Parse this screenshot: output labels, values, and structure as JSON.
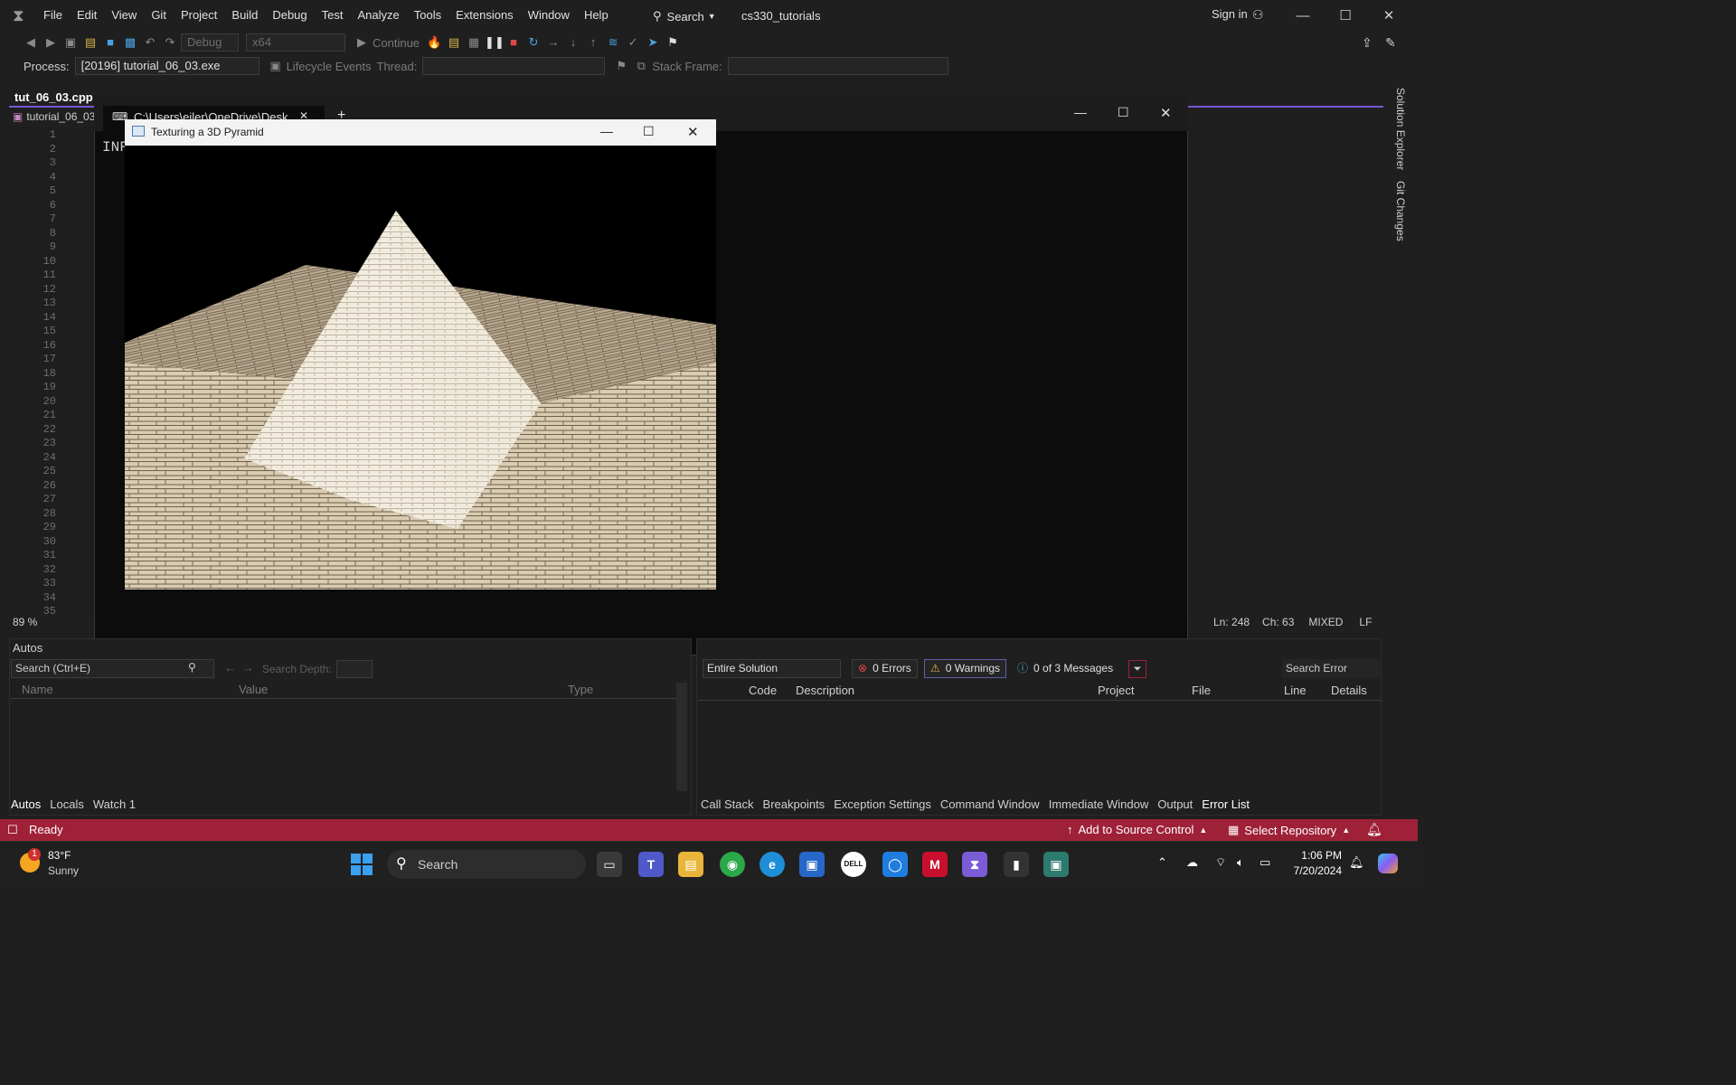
{
  "menubar": {
    "items": [
      "File",
      "Edit",
      "View",
      "Git",
      "Project",
      "Build",
      "Debug",
      "Test",
      "Analyze",
      "Tools",
      "Extensions",
      "Window",
      "Help"
    ],
    "search_label": "Search",
    "solution_name": "cs330_tutorials",
    "sign_in": "Sign in"
  },
  "toolbar": {
    "config": "Debug",
    "platform": "x64",
    "continue_label": "Continue",
    "process_label": "Process:",
    "process_value": "[20196] tutorial_06_03.exe",
    "lifecycle_label": "Lifecycle Events",
    "thread_label": "Thread:",
    "stack_frame_label": "Stack Frame:"
  },
  "editor": {
    "active_tab": "tut_06_03.cpp",
    "project_dropdown": "tutorial_06_03",
    "line_numbers": [
      "1",
      "2",
      "3",
      "4",
      "5",
      "6",
      "7",
      "8",
      "9",
      "10",
      "11",
      "12",
      "13",
      "14",
      "15",
      "16",
      "17",
      "18",
      "19",
      "20",
      "21",
      "22",
      "23",
      "24",
      "25",
      "26",
      "27",
      "28",
      "29",
      "30",
      "31",
      "32",
      "33",
      "34",
      "35"
    ],
    "zoom": "89 %",
    "ln": "Ln: 248",
    "ch": "Ch: 63",
    "encoding": "MIXED",
    "line_ending": "LF"
  },
  "console": {
    "tab_title": "C:\\Users\\eiler\\OneDrive\\Desk",
    "text": "INF"
  },
  "gl_window": {
    "title": "Texturing a 3D Pyramid"
  },
  "side_strip": {
    "solution_explorer": "Solution Explorer",
    "git_changes": "Git Changes"
  },
  "autos": {
    "title": "Autos",
    "search_placeholder": "Search (Ctrl+E)",
    "search_depth_label": "Search Depth:",
    "columns": [
      "Name",
      "Value",
      "Type"
    ],
    "tabs": [
      "Autos",
      "Locals",
      "Watch 1"
    ]
  },
  "errors": {
    "scope": "Entire Solution",
    "errors_count": "0 Errors",
    "warnings_count": "0 Warnings",
    "messages_count": "0 of 3 Messages",
    "search_placeholder": "Search Error",
    "columns": [
      "Code",
      "Description",
      "Project",
      "File",
      "Line",
      "Details"
    ],
    "tabs": [
      "Call Stack",
      "Breakpoints",
      "Exception Settings",
      "Command Window",
      "Immediate Window",
      "Output",
      "Error List"
    ]
  },
  "statusbar": {
    "ready": "Ready",
    "add_source": "Add to Source Control",
    "select_repo": "Select Repository"
  },
  "taskbar": {
    "weather_temp": "83°F",
    "weather_cond": "Sunny",
    "weather_badge": "1",
    "search_label": "Search",
    "time": "1:06 PM",
    "date": "7/20/2024"
  },
  "colors": {
    "accent": "#7a56d6",
    "statusbar": "#9e2138"
  }
}
